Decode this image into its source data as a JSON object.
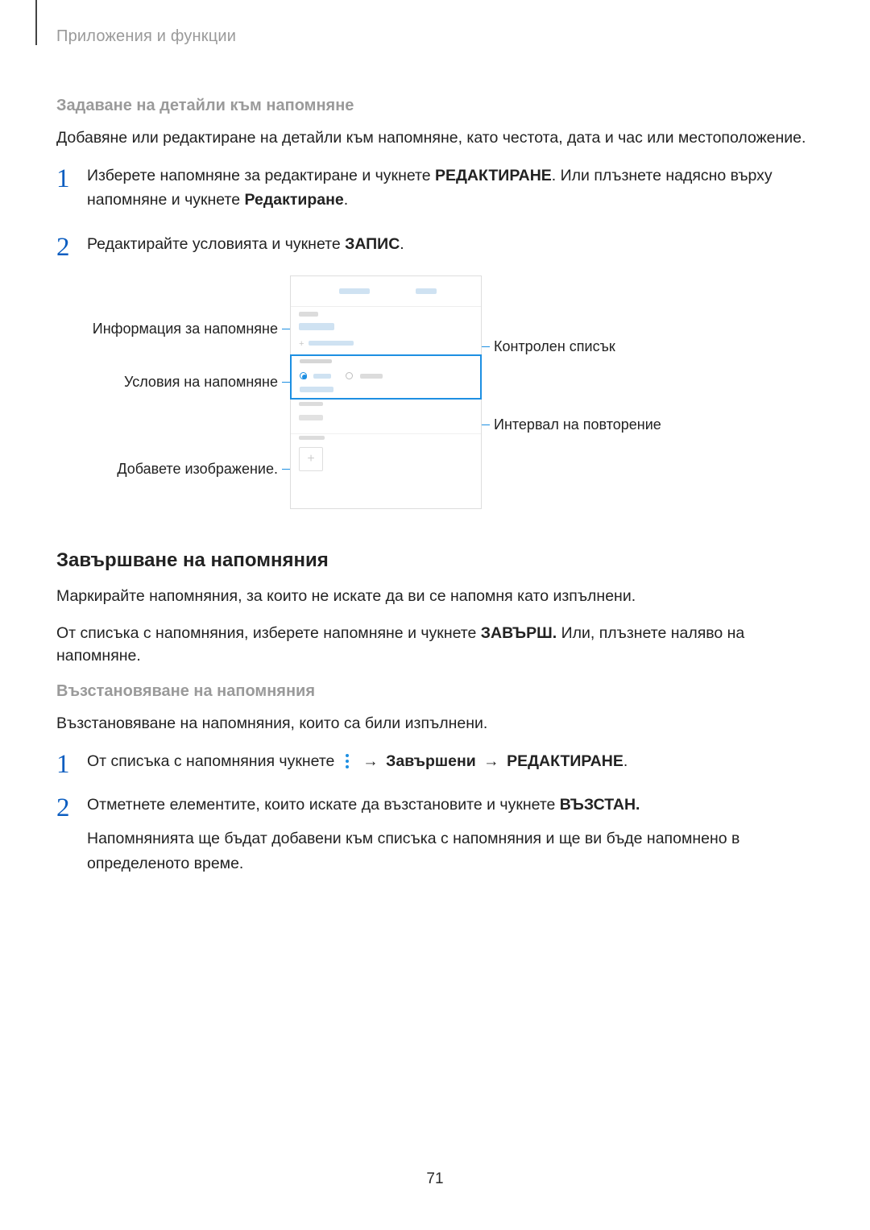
{
  "header": "Приложения и функции",
  "section1": {
    "heading": "Задаване на детайли към напомняне",
    "intro": "Добавяне или редактиране на детайли към напомняне, като честота, дата и час или местоположение.",
    "step1_a": "Изберете напомняне за редактиране и чукнете ",
    "step1_b1": "РЕДАКТИРАНЕ",
    "step1_c": ". Или плъзнете надясно върху напомняне и чукнете ",
    "step1_b2": "Редактиране",
    "step1_d": ".",
    "step2_a": "Редактирайте условията и чукнете ",
    "step2_b": "ЗАПИС",
    "step2_c": "."
  },
  "callouts": {
    "left1": "Информация за напомняне",
    "left2": "Условия на напомняне",
    "left3": "Добавете изображение.",
    "right1": "Контролен списък",
    "right2": "Интервал на повторение"
  },
  "section2": {
    "heading": "Завършване на напомняния",
    "p1": "Маркирайте напомняния, за които не искате да ви се напомня като изпълнени.",
    "p2_a": "От списъка с напомняния, изберете напомняне и чукнете ",
    "p2_b": "ЗАВЪРШ.",
    "p2_c": " Или, плъзнете наляво на напомняне."
  },
  "section3": {
    "heading": "Възстановяване на напомняния",
    "intro": "Възстановяване на напомняния, които са били изпълнени.",
    "step1_a": "От списъка с напомняния чукнете ",
    "step1_b": " → ",
    "step1_c": "Завършени",
    "step1_d": " → ",
    "step1_e": "РЕДАКТИРАНЕ",
    "step1_f": ".",
    "step2_a": "Отметнете елементите, които искате да възстановите и чукнете ",
    "step2_b": "ВЪЗСТАН.",
    "step2_p": "Напомнянията ще бъдат добавени към списъка с напомняния и ще ви бъде напомнено в определеното време."
  },
  "page_number": "71"
}
